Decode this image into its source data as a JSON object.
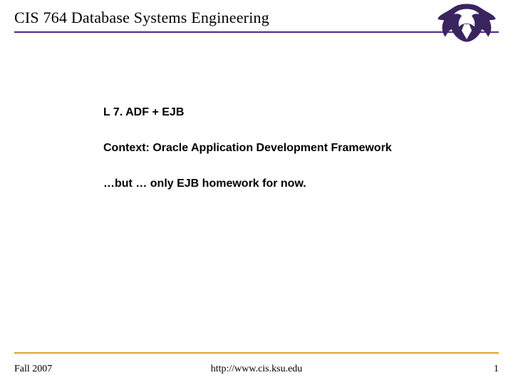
{
  "header": {
    "title": "CIS 764 Database Systems Engineering"
  },
  "content": {
    "line1": "L 7.  ADF  +  EJB",
    "line2": " Context:  Oracle Application Development Framework",
    "line3": "…but … only EJB  homework for now."
  },
  "footer": {
    "left": "Fall 2007",
    "center": "http://www.cis.ksu.edu",
    "right": "1"
  },
  "colors": {
    "title_underline": "#512888",
    "footer_line": "#daa520"
  }
}
